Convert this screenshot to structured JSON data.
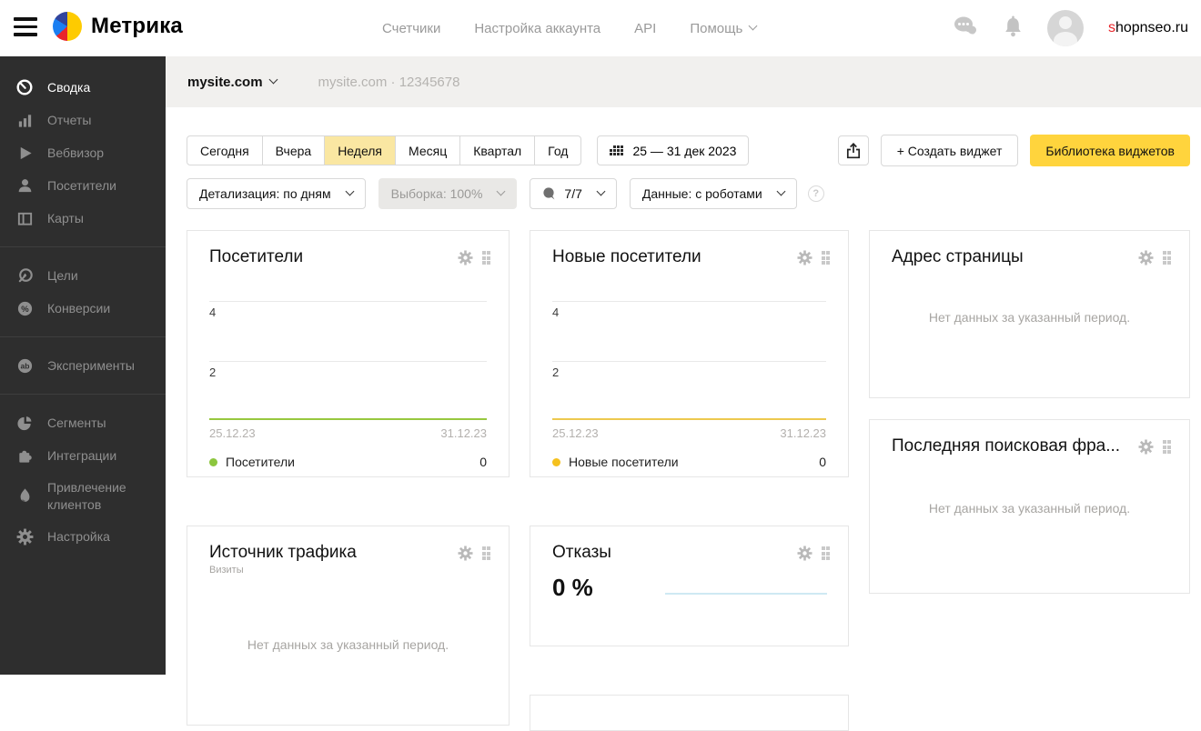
{
  "header": {
    "logo_text": "Метрика",
    "nav": [
      {
        "label": "Счетчики"
      },
      {
        "label": "Настройка аккаунта"
      },
      {
        "label": "API"
      },
      {
        "label": "Помощь",
        "has_dropdown": true
      }
    ],
    "account": "shopnseo.ru"
  },
  "sidebar": {
    "groups": [
      {
        "items": [
          {
            "icon": "dashboard-icon",
            "label": "Сводка",
            "active": true
          },
          {
            "icon": "reports-icon",
            "label": "Отчеты"
          },
          {
            "icon": "webvisor-icon",
            "label": "Вебвизор"
          },
          {
            "icon": "visitors-icon",
            "label": "Посетители"
          },
          {
            "icon": "maps-icon",
            "label": "Карты"
          }
        ]
      },
      {
        "items": [
          {
            "icon": "goals-icon",
            "label": "Цели"
          },
          {
            "icon": "conversions-icon",
            "label": "Конверсии"
          }
        ]
      },
      {
        "items": [
          {
            "icon": "experiments-icon",
            "label": "Эксперименты"
          }
        ]
      },
      {
        "items": [
          {
            "icon": "segments-icon",
            "label": "Сегменты"
          },
          {
            "icon": "integrations-icon",
            "label": "Интеграции"
          },
          {
            "icon": "acquisition-icon",
            "label": "Привлечение клиентов"
          },
          {
            "icon": "settings-icon",
            "label": "Настройка"
          }
        ]
      }
    ]
  },
  "site_bar": {
    "selector": "mysite.com",
    "info": "mysite.com · 12345678"
  },
  "toolbar": {
    "periods": [
      "Сегодня",
      "Вчера",
      "Неделя",
      "Месяц",
      "Квартал",
      "Год"
    ],
    "active_period": "Неделя",
    "date_range": "25 — 31 дек 2023",
    "create_widget": "+ Создать виджет",
    "widget_library": "Библиотека виджетов",
    "detail": "Детализация: по дням",
    "sampling": "Выборка: 100%",
    "comments": "7/7",
    "data_mode": "Данные: с роботами",
    "help": "?"
  },
  "widgets": {
    "visitors": {
      "title": "Посетители",
      "y_ticks": [
        "4",
        "2"
      ],
      "x_start": "25.12.23",
      "x_end": "31.12.23",
      "legend_label": "Посетители",
      "legend_value": "0"
    },
    "new_visitors": {
      "title": "Новые посетители",
      "y_ticks": [
        "4",
        "2"
      ],
      "x_start": "25.12.23",
      "x_end": "31.12.23",
      "legend_label": "Новые посетители",
      "legend_value": "0"
    },
    "page_address": {
      "title": "Адрес страницы",
      "empty_text": "Нет данных за указанный период."
    },
    "last_search_phrase": {
      "title": "Последняя поисковая фра...",
      "empty_text": "Нет данных за указанный период."
    },
    "traffic_source": {
      "title": "Источник трафика",
      "subtitle": "Визиты",
      "empty_text": "Нет данных за указанный период."
    },
    "bounces": {
      "title": "Отказы",
      "value": "0 %"
    }
  },
  "chart_data": [
    {
      "type": "line",
      "title": "Посетители",
      "x": [
        "25.12.23",
        "31.12.23"
      ],
      "series": [
        {
          "name": "Посетители",
          "values": [
            0,
            0,
            0,
            0,
            0,
            0,
            0
          ]
        }
      ],
      "ylim": [
        0,
        4
      ],
      "y_ticks": [
        2,
        4
      ],
      "line_color": "#97c83f",
      "legend_position": "bottom"
    },
    {
      "type": "line",
      "title": "Новые посетители",
      "x": [
        "25.12.23",
        "31.12.23"
      ],
      "series": [
        {
          "name": "Новые посетители",
          "values": [
            0,
            0,
            0,
            0,
            0,
            0,
            0
          ]
        }
      ],
      "ylim": [
        0,
        4
      ],
      "y_ticks": [
        2,
        4
      ],
      "line_color": "#edc94f",
      "legend_position": "bottom"
    },
    {
      "type": "line",
      "title": "Отказы",
      "series": [
        {
          "name": "Отказы",
          "values": [
            0
          ]
        }
      ],
      "value_label": "0 %",
      "line_color": "#cfe9f3"
    }
  ],
  "colors": {
    "accent_yellow": "#ffd43d",
    "active_tab_yellow": "#fae7a2",
    "sidebar_bg": "#2e2e2e",
    "brand_red": "#e8252b",
    "green_series": "#8cc63e",
    "yellow_series": "#f5c11e",
    "blue_series": "#cfe9f3"
  }
}
